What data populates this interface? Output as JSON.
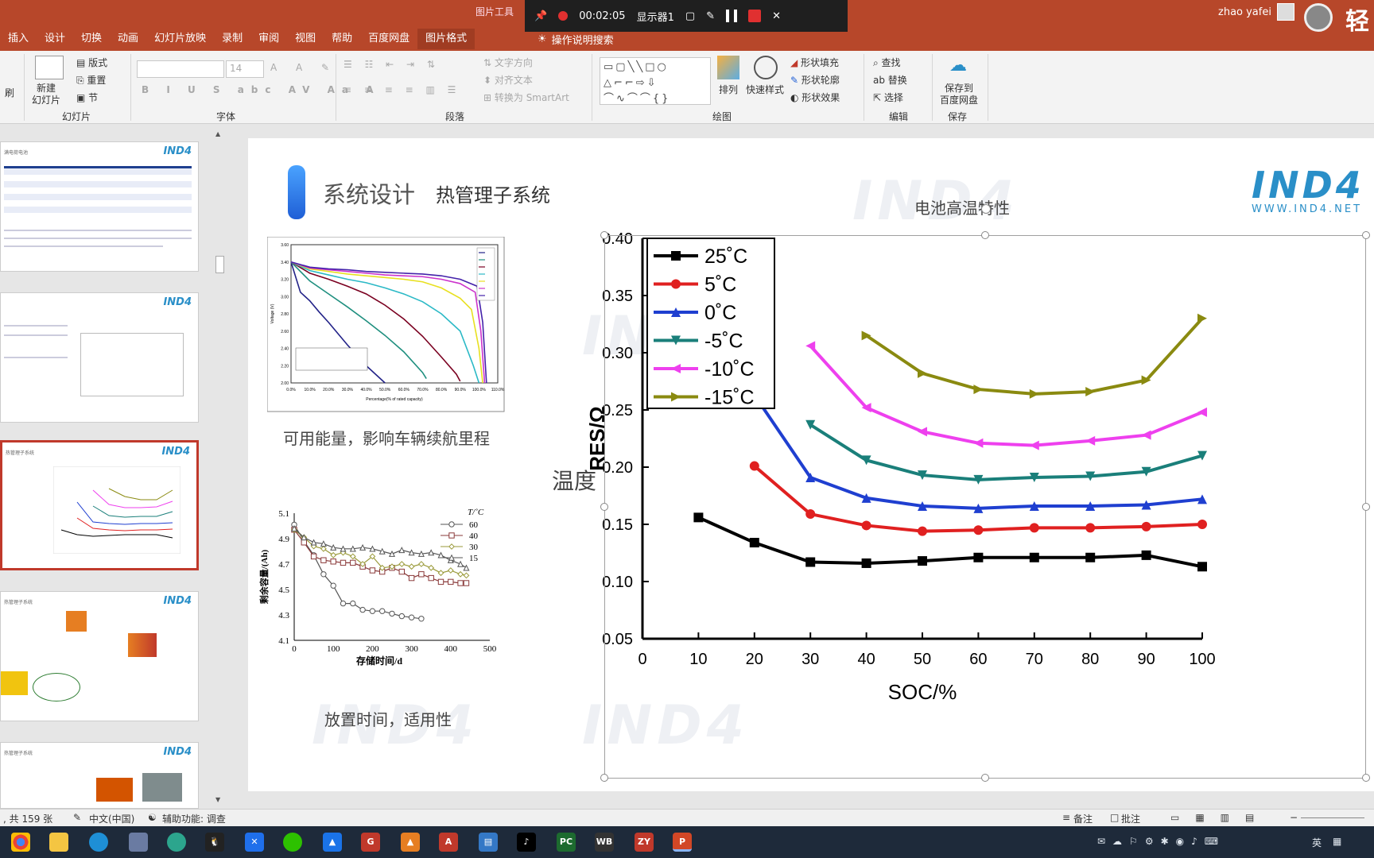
{
  "titlebar": {
    "tabs": [
      {
        "label": "插入"
      },
      {
        "label": "设计"
      },
      {
        "label": "切换"
      },
      {
        "label": "动画"
      },
      {
        "label": "幻灯片放映"
      },
      {
        "label": "录制"
      },
      {
        "label": "审阅"
      },
      {
        "label": "视图"
      },
      {
        "label": "帮助"
      },
      {
        "label": "百度网盘"
      },
      {
        "label": "图片格式"
      }
    ],
    "context_label": "图片工具",
    "tell_me": "操作说明搜索",
    "user_name": "zhao yafei",
    "brand_glyph": "轻"
  },
  "recorder": {
    "time": "00:02:05",
    "display": "显示器1"
  },
  "ribbon": {
    "slides": {
      "new_slide": "新建\n幻灯片",
      "layout": "版式",
      "reset": "重置",
      "section": "节",
      "group": "幻灯片"
    },
    "font": {
      "size": "14",
      "group": "字体"
    },
    "paragraph": {
      "text_direction": "文字方向",
      "align_text": "对齐文本",
      "smartart": "转换为 SmartArt",
      "group": "段落"
    },
    "drawing": {
      "arrange": "排列",
      "quick_styles": "快速样式",
      "shape_fill": "形状填充",
      "shape_outline": "形状轮廓",
      "shape_effects": "形状效果",
      "group": "绘图"
    },
    "editing": {
      "find": "查找",
      "replace": "替换",
      "select": "选择",
      "group": "编辑"
    },
    "save": {
      "save_baidu": "保存到\n百度网盘",
      "group": "保存"
    }
  },
  "slide": {
    "title": "系统设计",
    "subtitle": "热管理子系统",
    "logo": "IND4",
    "logo_url": "WWW.IND4.NET",
    "watermark": "IND4",
    "caption_energy": "可用能量，影响车辆续航里程",
    "caption_temp": "温度",
    "caption_storage": "放置时间，适用性",
    "caption_high_temp": "电池高温特性"
  },
  "status": {
    "slide_count": ", 共 159 张",
    "language": "中文(中国)",
    "accessibility": "辅助功能: 调查",
    "notes": "备注",
    "comments": "批注"
  },
  "thumbnails": [
    {
      "title": "满电荷电池"
    },
    {
      "title": ""
    },
    {
      "title": "热管理子系统"
    },
    {
      "title": "热管理子系统"
    },
    {
      "title": "热管理子系统"
    }
  ],
  "colors": {
    "ribbon_accent": "#b7472a",
    "selected_thumb": "#c0392b",
    "logo": "#2a8fc8"
  },
  "chart_data": [
    {
      "type": "line",
      "title": "",
      "xlabel": "SOC/%",
      "ylabel": "RES/Ω",
      "xlim": [
        0,
        100
      ],
      "ylim": [
        0.05,
        0.4
      ],
      "x_ticks": [
        "0",
        "10",
        "20",
        "30",
        "40",
        "50",
        "60",
        "70",
        "80",
        "90",
        "100"
      ],
      "y_ticks": [
        "0.05",
        "0.10",
        "0.15",
        "0.20",
        "0.25",
        "0.30",
        "0.35",
        "0.40"
      ],
      "legend_position": "top-left",
      "series": [
        {
          "name": "25˚C",
          "color": "#000000",
          "marker": "square",
          "x": [
            10,
            20,
            30,
            40,
            50,
            60,
            70,
            80,
            90,
            100
          ],
          "y": [
            0.156,
            0.134,
            0.117,
            0.116,
            0.118,
            0.121,
            0.121,
            0.121,
            0.123,
            0.113
          ]
        },
        {
          "name": "5˚C",
          "color": "#e02020",
          "marker": "circle",
          "x": [
            20,
            30,
            40,
            50,
            60,
            70,
            80,
            90,
            100
          ],
          "y": [
            0.201,
            0.159,
            0.149,
            0.144,
            0.145,
            0.147,
            0.147,
            0.148,
            0.15
          ]
        },
        {
          "name": "0˚C",
          "color": "#1f3fd0",
          "marker": "triangle-up",
          "x": [
            20,
            30,
            40,
            50,
            60,
            70,
            80,
            90,
            100
          ],
          "y": [
            0.263,
            0.191,
            0.173,
            0.166,
            0.164,
            0.166,
            0.166,
            0.167,
            0.172
          ]
        },
        {
          "name": "-5˚C",
          "color": "#1a7f7a",
          "marker": "triangle-down",
          "x": [
            30,
            40,
            50,
            60,
            70,
            80,
            90,
            100
          ],
          "y": [
            0.237,
            0.206,
            0.193,
            0.189,
            0.191,
            0.192,
            0.196,
            0.21
          ]
        },
        {
          "name": "-10˚C",
          "color": "#ee40ee",
          "marker": "triangle-left",
          "x": [
            30,
            40,
            50,
            60,
            70,
            80,
            90,
            100
          ],
          "y": [
            0.306,
            0.252,
            0.231,
            0.221,
            0.219,
            0.223,
            0.228,
            0.248
          ]
        },
        {
          "name": "-15˚C",
          "color": "#8a8a10",
          "marker": "triangle-right",
          "x": [
            40,
            50,
            60,
            70,
            80,
            90,
            100
          ],
          "y": [
            0.315,
            0.282,
            0.268,
            0.264,
            0.266,
            0.276,
            0.33
          ]
        }
      ]
    },
    {
      "type": "line",
      "xlabel": "存储时间/d",
      "ylabel": "剩余容量/(Ah)",
      "xlim": [
        0,
        500
      ],
      "ylim": [
        4.1,
        5.1
      ],
      "x_ticks": [
        "0",
        "100",
        "200",
        "300",
        "400",
        "500"
      ],
      "y_ticks": [
        "4.1",
        "4.3",
        "4.5",
        "4.7",
        "4.9",
        "5.1"
      ],
      "legend_title": "T/˚C",
      "legend_position": "top-right",
      "series": [
        {
          "name": "60",
          "marker": "circle",
          "x": [
            0,
            25,
            50,
            75,
            100,
            125,
            150,
            175,
            200,
            225,
            250,
            275,
            300,
            325
          ],
          "y": [
            5.01,
            4.88,
            4.77,
            4.62,
            4.53,
            4.39,
            4.39,
            4.34,
            4.33,
            4.33,
            4.31,
            4.29,
            4.28,
            4.27
          ]
        },
        {
          "name": "40",
          "marker": "square",
          "x": [
            0,
            25,
            50,
            75,
            100,
            125,
            150,
            175,
            200,
            225,
            250,
            275,
            300,
            325,
            350,
            375,
            400,
            425,
            440
          ],
          "y": [
            4.97,
            4.87,
            4.76,
            4.73,
            4.72,
            4.71,
            4.71,
            4.68,
            4.65,
            4.64,
            4.67,
            4.64,
            4.59,
            4.62,
            4.59,
            4.56,
            4.56,
            4.55,
            4.55
          ]
        },
        {
          "name": "30",
          "marker": "diamond",
          "x": [
            0,
            25,
            50,
            75,
            100,
            125,
            150,
            175,
            200,
            225,
            250,
            275,
            300,
            325,
            350,
            375,
            400,
            425,
            440
          ],
          "y": [
            4.97,
            4.91,
            4.84,
            4.82,
            4.77,
            4.79,
            4.76,
            4.7,
            4.76,
            4.67,
            4.68,
            4.7,
            4.68,
            4.7,
            4.67,
            4.63,
            4.65,
            4.62,
            4.61
          ]
        },
        {
          "name": "15",
          "marker": "triangle-up",
          "x": [
            0,
            25,
            50,
            75,
            100,
            125,
            150,
            175,
            200,
            225,
            250,
            275,
            300,
            325,
            350,
            375,
            400,
            425,
            440
          ],
          "y": [
            4.98,
            4.91,
            4.87,
            4.86,
            4.83,
            4.82,
            4.82,
            4.83,
            4.82,
            4.8,
            4.78,
            4.81,
            4.79,
            4.78,
            4.79,
            4.77,
            4.73,
            4.7,
            4.67
          ]
        }
      ]
    },
    {
      "type": "line",
      "xlabel": "Percentage(% of rated capacity)",
      "ylabel": "Voltage (V)",
      "xlim": [
        0,
        110
      ],
      "ylim": [
        2.0,
        3.6
      ],
      "x_ticks": [
        "0.0%",
        "10.0%",
        "20.0%",
        "30.0%",
        "40.0%",
        "50.0%",
        "60.0%",
        "70.0%",
        "80.0%",
        "90.0%",
        "100.0%",
        "110.0%"
      ],
      "y_ticks": [
        "2.00",
        "2.20",
        "2.40",
        "2.60",
        "2.80",
        "3.00",
        "3.20",
        "3.40",
        "3.60"
      ],
      "series": [
        {
          "color": "#222288",
          "x": [
            0,
            5,
            10,
            15,
            20,
            25,
            30,
            35,
            40,
            45,
            50
          ],
          "y": [
            3.4,
            3.05,
            2.95,
            2.82,
            2.7,
            2.57,
            2.44,
            2.32,
            2.2,
            2.1,
            2.0
          ]
        },
        {
          "color": "#1f8f7f",
          "x": [
            0,
            10,
            20,
            30,
            40,
            50,
            60,
            70,
            72
          ],
          "y": [
            3.4,
            3.18,
            3.03,
            2.88,
            2.72,
            2.55,
            2.36,
            2.12,
            2.05
          ]
        },
        {
          "color": "#7a0020",
          "x": [
            0,
            10,
            20,
            30,
            40,
            50,
            60,
            70,
            80,
            88,
            90
          ],
          "y": [
            3.4,
            3.27,
            3.2,
            3.12,
            3.03,
            2.9,
            2.74,
            2.54,
            2.3,
            2.1,
            2.02
          ]
        },
        {
          "color": "#2bb9c6",
          "x": [
            0,
            10,
            20,
            30,
            40,
            50,
            60,
            70,
            80,
            90,
            97,
            100
          ],
          "y": [
            3.4,
            3.3,
            3.25,
            3.2,
            3.16,
            3.1,
            3.03,
            2.94,
            2.8,
            2.6,
            2.2,
            2.0
          ]
        },
        {
          "color": "#e8e020",
          "x": [
            0,
            10,
            20,
            30,
            40,
            50,
            60,
            70,
            80,
            90,
            96,
            100,
            102
          ],
          "y": [
            3.4,
            3.32,
            3.29,
            3.26,
            3.24,
            3.22,
            3.2,
            3.17,
            3.1,
            2.98,
            2.85,
            2.4,
            2.0
          ]
        },
        {
          "color": "#cc33cc",
          "x": [
            0,
            10,
            20,
            30,
            40,
            50,
            60,
            70,
            80,
            90,
            98,
            101,
            103
          ],
          "y": [
            3.4,
            3.33,
            3.31,
            3.29,
            3.27,
            3.25,
            3.24,
            3.23,
            3.2,
            3.15,
            3.05,
            2.6,
            2.0
          ]
        },
        {
          "color": "#4422aa",
          "x": [
            0,
            10,
            20,
            30,
            40,
            50,
            60,
            70,
            80,
            90,
            99,
            102,
            104
          ],
          "y": [
            3.4,
            3.34,
            3.32,
            3.31,
            3.29,
            3.28,
            3.27,
            3.26,
            3.24,
            3.2,
            3.12,
            2.7,
            2.0
          ]
        }
      ]
    }
  ]
}
